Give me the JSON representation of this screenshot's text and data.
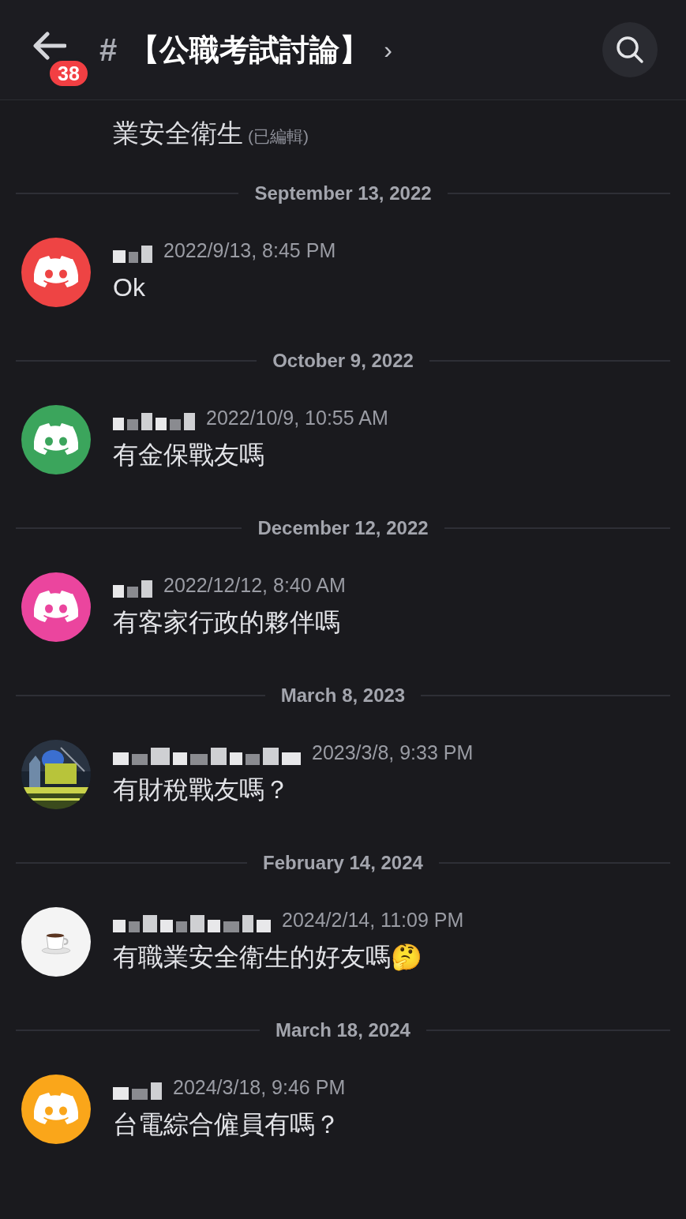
{
  "header": {
    "unread_count": "38",
    "hash": "#",
    "channel_name": "【公職考試討論】",
    "chevron": "›"
  },
  "top_message": {
    "text": "業安全衛生",
    "edited": "(已編輯)"
  },
  "items": [
    {
      "kind": "date",
      "label": "September 13, 2022"
    },
    {
      "kind": "message",
      "avatar": {
        "kind": "discord",
        "color": "#ee4444"
      },
      "time": "2022/9/13, 8:45 PM",
      "text": "Ok"
    },
    {
      "kind": "date",
      "label": "October 9, 2022"
    },
    {
      "kind": "message",
      "avatar": {
        "kind": "discord",
        "color": "#3ba55c"
      },
      "time": "2022/10/9, 10:55 AM",
      "text": "有金保戰友嗎"
    },
    {
      "kind": "date",
      "label": "December 12, 2022"
    },
    {
      "kind": "message",
      "avatar": {
        "kind": "discord",
        "color": "#eb459e"
      },
      "time": "2022/12/12, 8:40 AM",
      "text": "有客家行政的夥伴嗎"
    },
    {
      "kind": "date",
      "label": "March 8, 2023"
    },
    {
      "kind": "message",
      "time": "2023/3/8, 9:33 PM",
      "text": "有財稅戰友嗎？"
    },
    {
      "kind": "date",
      "label": "February 14, 2024"
    },
    {
      "kind": "message",
      "avatar": {
        "kind": "coffee"
      },
      "time": "2024/2/14, 11:09 PM",
      "text": "有職業安全衛生的好友嗎🤔"
    },
    {
      "kind": "date",
      "label": "March 18, 2024"
    },
    {
      "kind": "message",
      "avatar": {
        "kind": "discord",
        "color": "#faa61a"
      },
      "time": "2024/3/18, 9:46 PM",
      "text": "台電綜合僱員有嗎？"
    }
  ]
}
